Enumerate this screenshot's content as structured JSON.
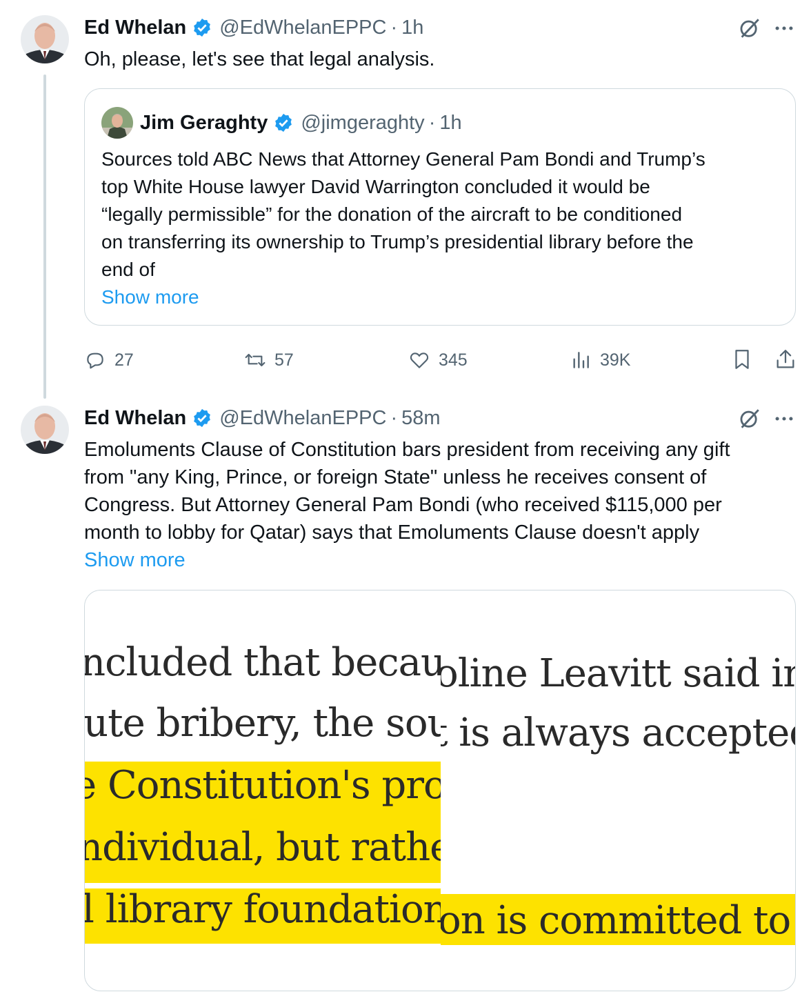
{
  "tweet1": {
    "name": "Ed Whelan",
    "handle": "@EdWhelanEPPC",
    "separator": "·",
    "time": "1h",
    "text": "Oh, please, let's see that legal analysis.",
    "quote": {
      "name": "Jim Geraghty",
      "handle": "@jimgeraghty",
      "separator": "·",
      "time": "1h",
      "lines": [
        "Sources told ABC News that Attorney General Pam Bondi and Trump’s",
        "top White House lawyer David Warrington concluded it would be",
        "“legally permissible” for the donation of the aircraft to be conditioned",
        "on transferring its ownership to Trump’s presidential library before the",
        "end of"
      ],
      "show_more": "Show more"
    },
    "actions": {
      "replies": "27",
      "reposts": "57",
      "likes": "345",
      "views": "39K"
    }
  },
  "tweet2": {
    "name": "Ed Whelan",
    "handle": "@EdWhelanEPPC",
    "separator": "·",
    "time": "58m",
    "lines": [
      "Emoluments Clause of Constitution bars president from receiving any gift",
      "from \"any King, Prince, or foreign State\" unless he receives consent of",
      "Congress. But Attorney General Pam Bondi (who received $115,000 per",
      "month to lobby for Qatar) says that Emoluments Clause doesn't apply"
    ],
    "show_more": "Show more",
    "media": {
      "left_lines": [
        "ncluded that becau",
        "ute bribery, the sou",
        "e Constitution's pro",
        "ndividual, but rathe",
        "l library foundation"
      ],
      "right_lines": [
        "oline Leavitt said in a",
        "t is always accepted",
        "on is committed to f"
      ],
      "highlight_color": "#fde200"
    }
  },
  "colors": {
    "accent": "#1d9bf0",
    "secondary_text": "#536471",
    "border": "#cfd9de"
  }
}
